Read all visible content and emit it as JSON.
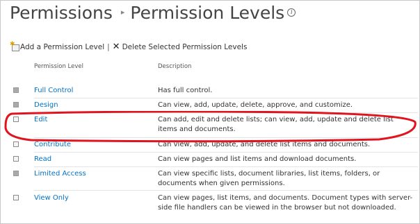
{
  "header": {
    "breadcrumb_parent": "Permissions",
    "breadcrumb_separator": "▸",
    "page_title": "Permission Levels",
    "info_icon_glyph": "i"
  },
  "toolbar": {
    "add_label": "Add a Permission Level",
    "divider": "|",
    "delete_label": "Delete Selected Permission Levels",
    "add_icon": "add-document-icon",
    "delete_icon": "x-icon"
  },
  "table": {
    "columns": [
      "Permission Level",
      "Description"
    ],
    "rows": [
      {
        "name": "Full Control",
        "description": "Has full control.",
        "checkbox_disabled": true
      },
      {
        "name": "Design",
        "description": "Can view, add, update, delete, approve, and customize.",
        "checkbox_disabled": true
      },
      {
        "name": "Edit",
        "description": "Can add, edit and delete lists; can view, add, update and delete list items and documents.",
        "checkbox_disabled": false
      },
      {
        "name": "Contribute",
        "description": "Can view, add, update, and delete list items and documents.",
        "checkbox_disabled": false
      },
      {
        "name": "Read",
        "description": "Can view pages and list items and download documents.",
        "checkbox_disabled": false
      },
      {
        "name": "Limited Access",
        "description": "Can view specific lists, document libraries, list items, folders, or documents when given permissions.",
        "checkbox_disabled": true
      },
      {
        "name": "View Only",
        "description": "Can view pages, list items, and documents. Document types with server-side file handlers can be viewed in the browser but not downloaded.",
        "checkbox_disabled": false
      }
    ]
  },
  "annotation": {
    "highlight_color": "#e0141e",
    "highlighted_row": "Edit"
  },
  "colors": {
    "link": "#0072c6",
    "title": "#444444"
  }
}
